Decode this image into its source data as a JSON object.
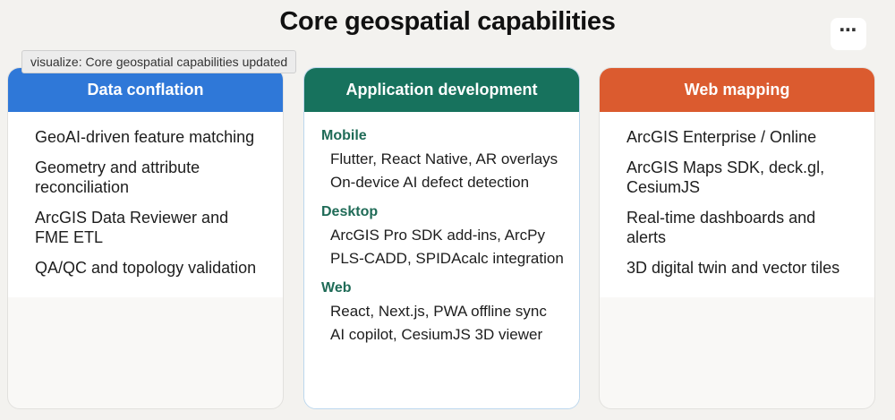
{
  "title": "Core geospatial capabilities",
  "more_button": "⋯",
  "tooltip": "visualize: Core geospatial capabilities updated",
  "colors": {
    "data_conflation": "#2f78d8",
    "application_development": "#17725d",
    "web_mapping": "#db5b2f"
  },
  "cards": [
    {
      "header": "Data conflation",
      "items": [
        "GeoAI-driven feature matching",
        "Geometry and attribute reconciliation",
        "ArcGIS Data Reviewer and FME ETL",
        "QA/QC and topology validation"
      ]
    },
    {
      "header": "Application development",
      "sections": [
        {
          "label": "Mobile",
          "items": [
            "Flutter, React Native, AR overlays",
            "On-device AI defect detection"
          ]
        },
        {
          "label": "Desktop",
          "items": [
            "ArcGIS Pro SDK add-ins, ArcPy",
            "PLS-CADD, SPIDAcalc integration"
          ]
        },
        {
          "label": "Web",
          "items": [
            "React, Next.js, PWA offline sync",
            "AI copilot, CesiumJS 3D viewer"
          ]
        }
      ]
    },
    {
      "header": "Web mapping",
      "items": [
        "ArcGIS Enterprise / Online",
        "ArcGIS Maps SDK, deck.gl, CesiumJS",
        "Real-time dashboards and alerts",
        "3D digital twin and vector tiles"
      ]
    }
  ]
}
